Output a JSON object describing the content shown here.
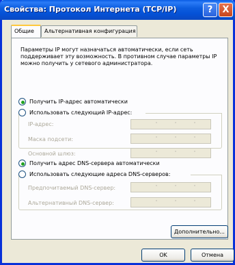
{
  "window": {
    "title": "Свойства: Протокол Интернета (TCP/IP)",
    "help_label": "?",
    "close_label": "X"
  },
  "tabs": [
    {
      "label": "Общие",
      "active": true
    },
    {
      "label": "Альтернативная конфигурация",
      "active": false
    }
  ],
  "description": "Параметры IP могут назначаться автоматически, если сеть поддерживает эту возможность. В противном случае параметры IP можно получить у сетевого администратора.",
  "ip_section": {
    "auto_label": "Получить IP-адрес автоматически",
    "manual_label": "Использовать следующий IP-адрес:",
    "auto_selected": true,
    "fields": [
      {
        "label": "IP-адрес:",
        "value": ""
      },
      {
        "label": "Маска подсети:",
        "value": ""
      },
      {
        "label": "Основной шлюз:",
        "value": ""
      }
    ]
  },
  "dns_section": {
    "auto_label": "Получить адрес DNS-сервера автоматически",
    "manual_label": "Использовать следующие адреса DNS-серверов:",
    "auto_selected": true,
    "fields": [
      {
        "label": "Предпочитаемый DNS-сервер:",
        "value": ""
      },
      {
        "label": "Альтернативный DNS-сервер:",
        "value": ""
      }
    ]
  },
  "buttons": {
    "advanced": "Дополнительно...",
    "ok": "OK",
    "cancel": "Отмена"
  },
  "colors": {
    "titlebar": "#0a5ce4",
    "dialog_bg": "#ece9d8",
    "radio_dot": "#21a121"
  }
}
